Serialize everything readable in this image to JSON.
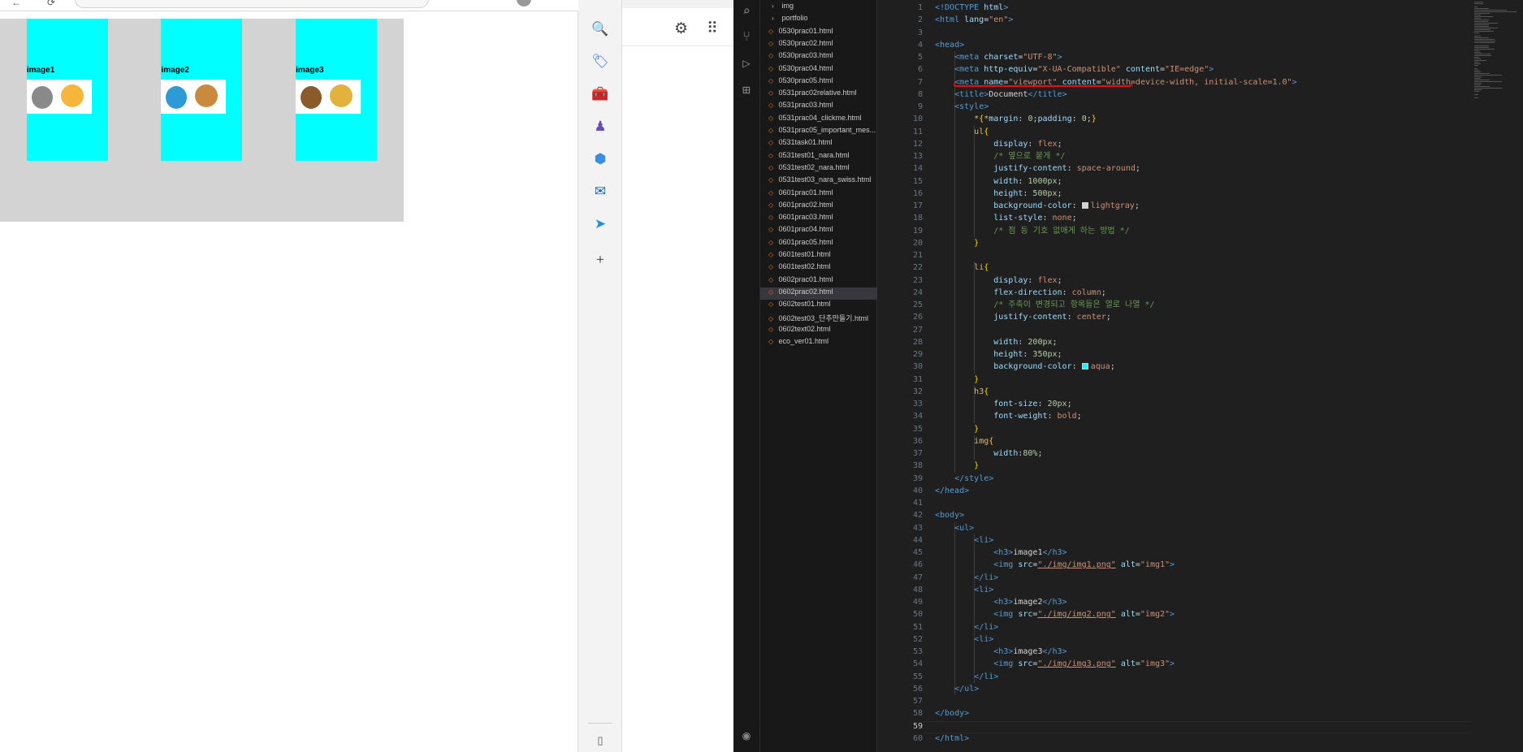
{
  "browser": {
    "demo_items": [
      {
        "heading": "image1",
        "alt": "img1"
      },
      {
        "heading": "image2",
        "alt": "img2"
      },
      {
        "heading": "image3",
        "alt": "img3"
      }
    ],
    "side_icons": [
      "search-icon",
      "tag-icon",
      "toolbox-icon",
      "chess-icon",
      "copilot-icon",
      "outlook-icon",
      "send-icon",
      "plus-icon",
      "sidebar-icon"
    ]
  },
  "explorer": {
    "items": [
      {
        "label": "img",
        "type": "folder"
      },
      {
        "label": "portfolio",
        "type": "folder"
      },
      {
        "label": "0530prac01.html",
        "type": "file"
      },
      {
        "label": "0530prac02.html",
        "type": "file"
      },
      {
        "label": "0530prac03.html",
        "type": "file"
      },
      {
        "label": "0530prac04.html",
        "type": "file"
      },
      {
        "label": "0530prac05.html",
        "type": "file"
      },
      {
        "label": "0531prac02relative.html",
        "type": "file"
      },
      {
        "label": "0531prac03.html",
        "type": "file"
      },
      {
        "label": "0531prac04_clickme.html",
        "type": "file"
      },
      {
        "label": "0531prac05_important_mes...",
        "type": "file"
      },
      {
        "label": "0531task01.html",
        "type": "file"
      },
      {
        "label": "0531test01_nara.html",
        "type": "file"
      },
      {
        "label": "0531test02_nara.html",
        "type": "file"
      },
      {
        "label": "0531test03_nara_swiss.html",
        "type": "file"
      },
      {
        "label": "0601prac01.html",
        "type": "file"
      },
      {
        "label": "0601prac02.html",
        "type": "file"
      },
      {
        "label": "0601prac03.html",
        "type": "file"
      },
      {
        "label": "0601prac04.html",
        "type": "file"
      },
      {
        "label": "0601prac05.html",
        "type": "file"
      },
      {
        "label": "0601test01.html",
        "type": "file"
      },
      {
        "label": "0601test02.html",
        "type": "file"
      },
      {
        "label": "0602prac01.html",
        "type": "file"
      },
      {
        "label": "0602prac02.html",
        "type": "file",
        "active": true
      },
      {
        "label": "0602test01.html",
        "type": "file"
      },
      {
        "label": "0602test03_단추만들기.html",
        "type": "file"
      },
      {
        "label": "0602text02.html",
        "type": "file"
      },
      {
        "label": "eco_ver01.html",
        "type": "file"
      }
    ]
  },
  "editor": {
    "current_line": 59,
    "lines": [
      [
        [
          "tag",
          "<!DOCTYPE "
        ],
        [
          "attr",
          "html"
        ],
        [
          "tag",
          ">"
        ]
      ],
      [
        [
          "tag",
          "<html "
        ],
        [
          "attr",
          "lang"
        ],
        [
          "text",
          "="
        ],
        [
          "str",
          "\"en\""
        ],
        [
          "tag",
          ">"
        ]
      ],
      [],
      [
        [
          "tag",
          "<head>"
        ]
      ],
      [
        [
          "text",
          "    "
        ],
        [
          "tag",
          "<meta "
        ],
        [
          "attr",
          "charset"
        ],
        [
          "text",
          "="
        ],
        [
          "str",
          "\"UTF-8\""
        ],
        [
          "tag",
          ">"
        ]
      ],
      [
        [
          "text",
          "    "
        ],
        [
          "tag",
          "<meta "
        ],
        [
          "attr",
          "http-equiv"
        ],
        [
          "text",
          "="
        ],
        [
          "str",
          "\"X-UA-Compatible\""
        ],
        [
          "text",
          " "
        ],
        [
          "attr",
          "content"
        ],
        [
          "text",
          "="
        ],
        [
          "str",
          "\"IE=edge\""
        ],
        [
          "tag",
          ">"
        ]
      ],
      [
        [
          "text",
          "    "
        ],
        [
          "tag",
          "<meta "
        ],
        [
          "attr",
          "name"
        ],
        [
          "text",
          "="
        ],
        [
          "str",
          "\"viewport\""
        ],
        [
          "text",
          " "
        ],
        [
          "attr",
          "content"
        ],
        [
          "text",
          "="
        ],
        [
          "str",
          "\"width=device-width, initial-scale=1.0\""
        ],
        [
          "tag",
          ">"
        ]
      ],
      [
        [
          "text",
          "    "
        ],
        [
          "tag",
          "<title>"
        ],
        [
          "text",
          "Document"
        ],
        [
          "tag",
          "</title>"
        ]
      ],
      [
        [
          "text",
          "    "
        ],
        [
          "tag",
          "<style>"
        ]
      ],
      [
        [
          "text",
          "        "
        ],
        [
          "sel",
          "*"
        ],
        [
          "brace",
          "{"
        ],
        [
          "sel",
          "*"
        ],
        [
          "prop",
          "margin"
        ],
        [
          "text",
          ": "
        ],
        [
          "num",
          "0"
        ],
        [
          "text",
          ";"
        ],
        [
          "prop",
          "padding"
        ],
        [
          "text",
          ": "
        ],
        [
          "num",
          "0"
        ],
        [
          "text",
          ";"
        ],
        [
          "brace",
          "}"
        ]
      ],
      [
        [
          "text",
          "        "
        ],
        [
          "sel",
          "ul"
        ],
        [
          "brace",
          "{"
        ]
      ],
      [
        [
          "text",
          "            "
        ],
        [
          "prop",
          "display"
        ],
        [
          "text",
          ": "
        ],
        [
          "val",
          "flex"
        ],
        [
          "text",
          ";"
        ]
      ],
      [
        [
          "text",
          "            "
        ],
        [
          "com",
          "/* 옆으로 붙게 */"
        ]
      ],
      [
        [
          "text",
          "            "
        ],
        [
          "prop",
          "justify-content"
        ],
        [
          "text",
          ": "
        ],
        [
          "val",
          "space-around"
        ],
        [
          "text",
          ";"
        ]
      ],
      [
        [
          "text",
          "            "
        ],
        [
          "prop",
          "width"
        ],
        [
          "text",
          ": "
        ],
        [
          "num",
          "1000px"
        ],
        [
          "text",
          ";"
        ]
      ],
      [
        [
          "text",
          "            "
        ],
        [
          "prop",
          "height"
        ],
        [
          "text",
          ": "
        ],
        [
          "num",
          "500px"
        ],
        [
          "text",
          ";"
        ]
      ],
      [
        [
          "text",
          "            "
        ],
        [
          "prop",
          "background-color"
        ],
        [
          "text",
          ": "
        ],
        [
          "swatch",
          "#d3d3d3"
        ],
        [
          "val",
          "lightgray"
        ],
        [
          "text",
          ";"
        ]
      ],
      [
        [
          "text",
          "            "
        ],
        [
          "prop",
          "list-style"
        ],
        [
          "text",
          ": "
        ],
        [
          "val",
          "none"
        ],
        [
          "text",
          ";"
        ]
      ],
      [
        [
          "text",
          "            "
        ],
        [
          "com",
          "/* 점 등 기호 없애게 하는 방법 */"
        ]
      ],
      [
        [
          "text",
          "        "
        ],
        [
          "brace",
          "}"
        ]
      ],
      [],
      [
        [
          "text",
          "        "
        ],
        [
          "sel",
          "li"
        ],
        [
          "brace",
          "{"
        ]
      ],
      [
        [
          "text",
          "            "
        ],
        [
          "prop",
          "display"
        ],
        [
          "text",
          ": "
        ],
        [
          "val",
          "flex"
        ],
        [
          "text",
          ";"
        ]
      ],
      [
        [
          "text",
          "            "
        ],
        [
          "prop",
          "flex-direction"
        ],
        [
          "text",
          ": "
        ],
        [
          "val",
          "column"
        ],
        [
          "text",
          ";"
        ]
      ],
      [
        [
          "text",
          "            "
        ],
        [
          "com",
          "/* 주축이 변경되고 항목들은 열로 나열 */"
        ]
      ],
      [
        [
          "text",
          "            "
        ],
        [
          "prop",
          "justify-content"
        ],
        [
          "text",
          ": "
        ],
        [
          "val",
          "center"
        ],
        [
          "text",
          ";"
        ]
      ],
      [],
      [
        [
          "text",
          "            "
        ],
        [
          "prop",
          "width"
        ],
        [
          "text",
          ": "
        ],
        [
          "num",
          "200px"
        ],
        [
          "text",
          ";"
        ]
      ],
      [
        [
          "text",
          "            "
        ],
        [
          "prop",
          "height"
        ],
        [
          "text",
          ": "
        ],
        [
          "num",
          "350px"
        ],
        [
          "text",
          ";"
        ]
      ],
      [
        [
          "text",
          "            "
        ],
        [
          "prop",
          "background-color"
        ],
        [
          "text",
          ": "
        ],
        [
          "swatch",
          "#00ffff"
        ],
        [
          "val",
          "aqua"
        ],
        [
          "text",
          ";"
        ]
      ],
      [
        [
          "text",
          "        "
        ],
        [
          "brace",
          "}"
        ]
      ],
      [
        [
          "text",
          "        "
        ],
        [
          "sel",
          "h3"
        ],
        [
          "brace",
          "{"
        ]
      ],
      [
        [
          "text",
          "            "
        ],
        [
          "prop",
          "font-size"
        ],
        [
          "text",
          ": "
        ],
        [
          "num",
          "20px"
        ],
        [
          "text",
          ";"
        ]
      ],
      [
        [
          "text",
          "            "
        ],
        [
          "prop",
          "font-weight"
        ],
        [
          "text",
          ": "
        ],
        [
          "val",
          "bold"
        ],
        [
          "text",
          ";"
        ]
      ],
      [
        [
          "text",
          "        "
        ],
        [
          "brace",
          "}"
        ]
      ],
      [
        [
          "text",
          "        "
        ],
        [
          "sel",
          "img"
        ],
        [
          "brace",
          "{"
        ]
      ],
      [
        [
          "text",
          "            "
        ],
        [
          "prop",
          "width"
        ],
        [
          "text",
          ":"
        ],
        [
          "num",
          "80%"
        ],
        [
          "text",
          ";"
        ]
      ],
      [
        [
          "text",
          "        "
        ],
        [
          "brace",
          "}"
        ]
      ],
      [
        [
          "text",
          "    "
        ],
        [
          "tag",
          "</style>"
        ]
      ],
      [
        [
          "tag",
          "</head>"
        ]
      ],
      [],
      [
        [
          "tag",
          "<body>"
        ]
      ],
      [
        [
          "text",
          "    "
        ],
        [
          "tag",
          "<ul>"
        ]
      ],
      [
        [
          "text",
          "        "
        ],
        [
          "tag",
          "<li>"
        ]
      ],
      [
        [
          "text",
          "            "
        ],
        [
          "tag",
          "<h3>"
        ],
        [
          "text",
          "image1"
        ],
        [
          "tag",
          "</h3>"
        ]
      ],
      [
        [
          "text",
          "            "
        ],
        [
          "tag",
          "<img "
        ],
        [
          "attr",
          "src"
        ],
        [
          "text",
          "="
        ],
        [
          "link",
          "\"./img/img1.png\""
        ],
        [
          "text",
          " "
        ],
        [
          "attr",
          "alt"
        ],
        [
          "text",
          "="
        ],
        [
          "str",
          "\"img1\""
        ],
        [
          "tag",
          ">"
        ]
      ],
      [
        [
          "text",
          "        "
        ],
        [
          "tag",
          "</li>"
        ]
      ],
      [
        [
          "text",
          "        "
        ],
        [
          "tag",
          "<li>"
        ]
      ],
      [
        [
          "text",
          "            "
        ],
        [
          "tag",
          "<h3>"
        ],
        [
          "text",
          "image2"
        ],
        [
          "tag",
          "</h3>"
        ]
      ],
      [
        [
          "text",
          "            "
        ],
        [
          "tag",
          "<img "
        ],
        [
          "attr",
          "src"
        ],
        [
          "text",
          "="
        ],
        [
          "link",
          "\"./img/img2.png\""
        ],
        [
          "text",
          " "
        ],
        [
          "attr",
          "alt"
        ],
        [
          "text",
          "="
        ],
        [
          "str",
          "\"img2\""
        ],
        [
          "tag",
          ">"
        ]
      ],
      [
        [
          "text",
          "        "
        ],
        [
          "tag",
          "</li>"
        ]
      ],
      [
        [
          "text",
          "        "
        ],
        [
          "tag",
          "<li>"
        ]
      ],
      [
        [
          "text",
          "            "
        ],
        [
          "tag",
          "<h3>"
        ],
        [
          "text",
          "image3"
        ],
        [
          "tag",
          "</h3>"
        ]
      ],
      [
        [
          "text",
          "            "
        ],
        [
          "tag",
          "<img "
        ],
        [
          "attr",
          "src"
        ],
        [
          "text",
          "="
        ],
        [
          "link",
          "\"./img/img3.png\""
        ],
        [
          "text",
          " "
        ],
        [
          "attr",
          "alt"
        ],
        [
          "text",
          "="
        ],
        [
          "str",
          "\"img3\""
        ],
        [
          "tag",
          ">"
        ]
      ],
      [
        [
          "text",
          "        "
        ],
        [
          "tag",
          "</li>"
        ]
      ],
      [
        [
          "text",
          "    "
        ],
        [
          "tag",
          "</ul>"
        ]
      ],
      [],
      [
        [
          "tag",
          "</body>"
        ]
      ],
      [],
      [
        [
          "tag",
          "</html>"
        ]
      ]
    ]
  },
  "colors": {
    "aqua": "#00ffff",
    "lightgray": "#d3d3d3",
    "annotation_red": "#e21212"
  }
}
